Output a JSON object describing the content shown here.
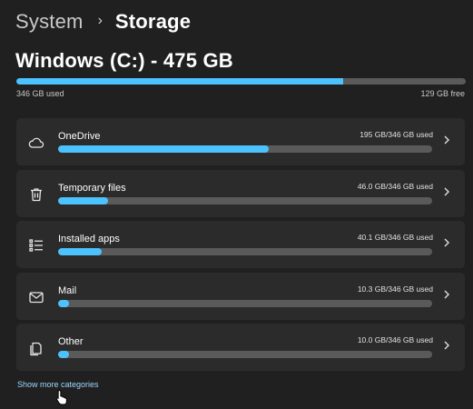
{
  "breadcrumb": {
    "parent": "System",
    "separator": "›",
    "current": "Storage"
  },
  "drive": {
    "title": "Windows (C:) - 475 GB",
    "used_label": "346 GB used",
    "free_label": "129 GB free",
    "used_fraction": 0.728
  },
  "categories": [
    {
      "name": "OneDrive",
      "usage": "195 GB/346 GB used",
      "fraction": 0.564,
      "icon": "cloud-icon"
    },
    {
      "name": "Temporary files",
      "usage": "46.0 GB/346 GB used",
      "fraction": 0.133,
      "icon": "trash-icon"
    },
    {
      "name": "Installed apps",
      "usage": "40.1 GB/346 GB used",
      "fraction": 0.116,
      "icon": "apps-list-icon"
    },
    {
      "name": "Mail",
      "usage": "10.3 GB/346 GB used",
      "fraction": 0.03,
      "icon": "mail-icon"
    },
    {
      "name": "Other",
      "usage": "10.0 GB/346 GB used",
      "fraction": 0.029,
      "icon": "document-icon"
    }
  ],
  "show_more_label": "Show more categories",
  "colors": {
    "background": "#202020",
    "card": "#2b2b2b",
    "accent": "#4cc2ff",
    "track": "#5a5a5a",
    "link": "#9ad8ff"
  }
}
